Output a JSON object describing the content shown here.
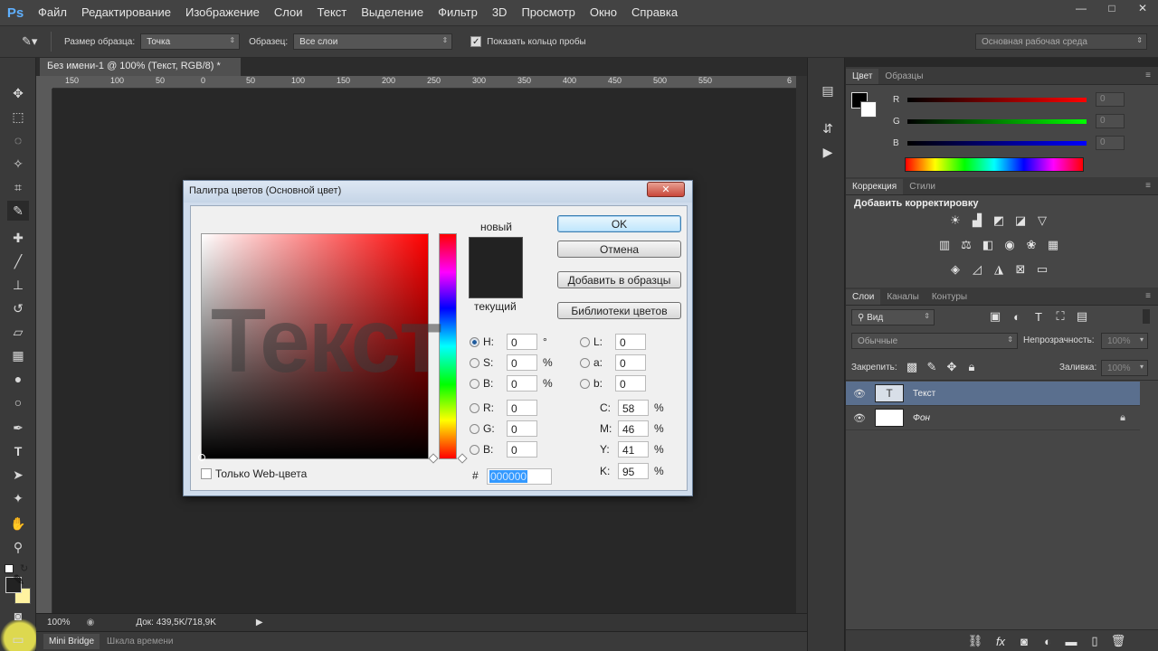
{
  "app": {
    "logo": "Ps"
  },
  "menu": [
    "Файл",
    "Редактирование",
    "Изображение",
    "Слои",
    "Текст",
    "Выделение",
    "Фильтр",
    "3D",
    "Просмотр",
    "Окно",
    "Справка"
  ],
  "window_controls": {
    "minimize": "—",
    "maximize": "□",
    "close": "✕"
  },
  "options_bar": {
    "sample_size_label": "Размер образца:",
    "sample_size_value": "Точка",
    "sample_label": "Образец:",
    "sample_value": "Все слои",
    "show_ring_label": "Показать кольцо пробы",
    "workspace": "Основная рабочая среда"
  },
  "document": {
    "tab_title": "Без имени-1 @ 100% (Текст, RGB/8) *",
    "ruler_ticks": [
      "150",
      "100",
      "50",
      "0",
      "50",
      "100",
      "150",
      "200",
      "250",
      "300",
      "350",
      "400",
      "450",
      "500",
      "550",
      "6"
    ],
    "zoom": "100%",
    "doc_info": "Док: 439,5K/718,9K"
  },
  "bottom_tabs": [
    "Mini Bridge",
    "Шкала времени"
  ],
  "color_panel": {
    "tabs": [
      "Цвет",
      "Образцы"
    ],
    "channels": [
      {
        "label": "R",
        "value": "0",
        "gradient": "linear-gradient(to right,#000,#ff0000)"
      },
      {
        "label": "G",
        "value": "0",
        "gradient": "linear-gradient(to right,#000,#00ff00)"
      },
      {
        "label": "B",
        "value": "0",
        "gradient": "linear-gradient(to right,#000,#0000ff)"
      }
    ]
  },
  "adjustments_panel": {
    "tabs": [
      "Коррекция",
      "Стили"
    ],
    "heading": "Добавить корректировку"
  },
  "layers_panel": {
    "tabs": [
      "Слои",
      "Каналы",
      "Контуры"
    ],
    "filter_label": "Вид",
    "blend_mode": "Обычные",
    "opacity_label": "Непрозрачность:",
    "opacity_value": "100%",
    "lock_label": "Закрепить:",
    "fill_label": "Заливка:",
    "fill_value": "100%",
    "layers": [
      {
        "name": "Текст",
        "thumb": "T",
        "selected": true
      },
      {
        "name": "Фон",
        "thumb": "",
        "selected": false,
        "locked": true
      }
    ]
  },
  "color_picker": {
    "title": "Палитра цветов (Основной цвет)",
    "close_label": "✕",
    "ghost_text": "Текст",
    "new_label": "новый",
    "current_label": "текущий",
    "buttons": {
      "ok": "OK",
      "cancel": "Отмена",
      "add_swatch": "Добавить в образцы",
      "libraries": "Библиотеки цветов"
    },
    "web_only_label": "Только Web-цвета",
    "hsb": [
      {
        "label": "H:",
        "value": "0",
        "unit": "°",
        "selected": true
      },
      {
        "label": "S:",
        "value": "0",
        "unit": "%"
      },
      {
        "label": "B:",
        "value": "0",
        "unit": "%"
      }
    ],
    "rgb": [
      {
        "label": "R:",
        "value": "0"
      },
      {
        "label": "G:",
        "value": "0"
      },
      {
        "label": "B:",
        "value": "0"
      }
    ],
    "lab": [
      {
        "label": "L:",
        "value": "0"
      },
      {
        "label": "a:",
        "value": "0"
      },
      {
        "label": "b:",
        "value": "0"
      }
    ],
    "cmyk": [
      {
        "label": "C:",
        "value": "58",
        "unit": "%"
      },
      {
        "label": "M:",
        "value": "46",
        "unit": "%"
      },
      {
        "label": "Y:",
        "value": "41",
        "unit": "%"
      },
      {
        "label": "K:",
        "value": "95",
        "unit": "%"
      }
    ],
    "hex_label": "#",
    "hex_value": "000000",
    "new_color": "#222222"
  }
}
